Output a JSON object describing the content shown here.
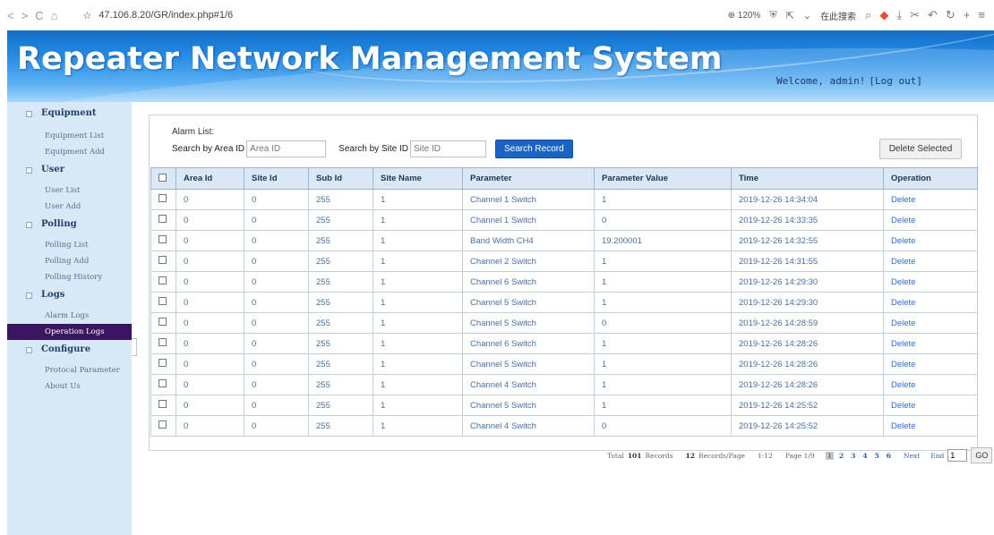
{
  "browser": {
    "nav": [
      "<",
      ">",
      "C",
      "⌂"
    ],
    "url": "47.106.8.20/GR/index.php#1/6",
    "zoom": "⊕ 120%",
    "search": "在此搜索"
  },
  "header": {
    "title": "Repeater Network Management System",
    "welcome": "Welcome, admin!",
    "logout": "[Log out]"
  },
  "sidebar": {
    "groups": [
      {
        "label": "Equipment",
        "items": [
          "Equipment List",
          "Equipment Add"
        ]
      },
      {
        "label": "User",
        "items": [
          "User List",
          "User Add"
        ]
      },
      {
        "label": "Polling",
        "items": [
          "Polling List",
          "Polling Add",
          "Polling History"
        ]
      },
      {
        "label": "Logs",
        "items": [
          "Alarm Logs",
          "Operation Logs"
        ]
      },
      {
        "label": "Configure",
        "items": [
          "Protocal Parameter",
          "About Us"
        ]
      }
    ],
    "active_item": "Operation Logs"
  },
  "panel": {
    "title": "Alarm List:",
    "search_area_label": "Search by Area ID",
    "search_area_placeholder": "Area ID",
    "search_site_label": "Search by Site ID",
    "search_site_placeholder": "Site ID",
    "search_button": "Search Record",
    "delete_button": "Delete Selected"
  },
  "table": {
    "columns": [
      "Area Id",
      "Site Id",
      "Sub Id",
      "Site Name",
      "Parameter",
      "Parameter Value",
      "Time",
      "Operation"
    ],
    "rows": [
      [
        "0",
        "0",
        "255",
        "1",
        "Channel 1 Switch",
        "1",
        "2019-12-26 14:34:04",
        "Delete"
      ],
      [
        "0",
        "0",
        "255",
        "1",
        "Channel 1 Switch",
        "0",
        "2019-12-26 14:33:35",
        "Delete"
      ],
      [
        "0",
        "0",
        "255",
        "1",
        "Band Width CH4",
        "19.200001",
        "2019-12-26 14:32:55",
        "Delete"
      ],
      [
        "0",
        "0",
        "255",
        "1",
        "Channel 2 Switch",
        "1",
        "2019-12-26 14:31:55",
        "Delete"
      ],
      [
        "0",
        "0",
        "255",
        "1",
        "Channel 6 Switch",
        "1",
        "2019-12-26 14:29:30",
        "Delete"
      ],
      [
        "0",
        "0",
        "255",
        "1",
        "Channel 5 Switch",
        "1",
        "2019-12-26 14:29:30",
        "Delete"
      ],
      [
        "0",
        "0",
        "255",
        "1",
        "Channel 5 Switch",
        "0",
        "2019-12-26 14:28:59",
        "Delete"
      ],
      [
        "0",
        "0",
        "255",
        "1",
        "Channel 6 Switch",
        "1",
        "2019-12-26 14:28:26",
        "Delete"
      ],
      [
        "0",
        "0",
        "255",
        "1",
        "Channel 5 Switch",
        "1",
        "2019-12-26 14:28:26",
        "Delete"
      ],
      [
        "0",
        "0",
        "255",
        "1",
        "Channel 4 Switch",
        "1",
        "2019-12-26 14:28:26",
        "Delete"
      ],
      [
        "0",
        "0",
        "255",
        "1",
        "Channel 5 Switch",
        "1",
        "2019-12-26 14:25:52",
        "Delete"
      ],
      [
        "0",
        "0",
        "255",
        "1",
        "Channel 4 Switch",
        "0",
        "2019-12-26 14:25:52",
        "Delete"
      ]
    ]
  },
  "pager": {
    "total_prefix": "Total",
    "total_records": "101",
    "total_suffix": "Records",
    "per_page": "12",
    "per_page_suffix": "Records/Page",
    "range": "1-12",
    "page_info": "Page 1/9",
    "pages": [
      "1",
      "2",
      "3",
      "4",
      "5",
      "6"
    ],
    "current_page": "1",
    "next": "Next",
    "end": "End",
    "goto_value": "1",
    "go": "GO"
  }
}
